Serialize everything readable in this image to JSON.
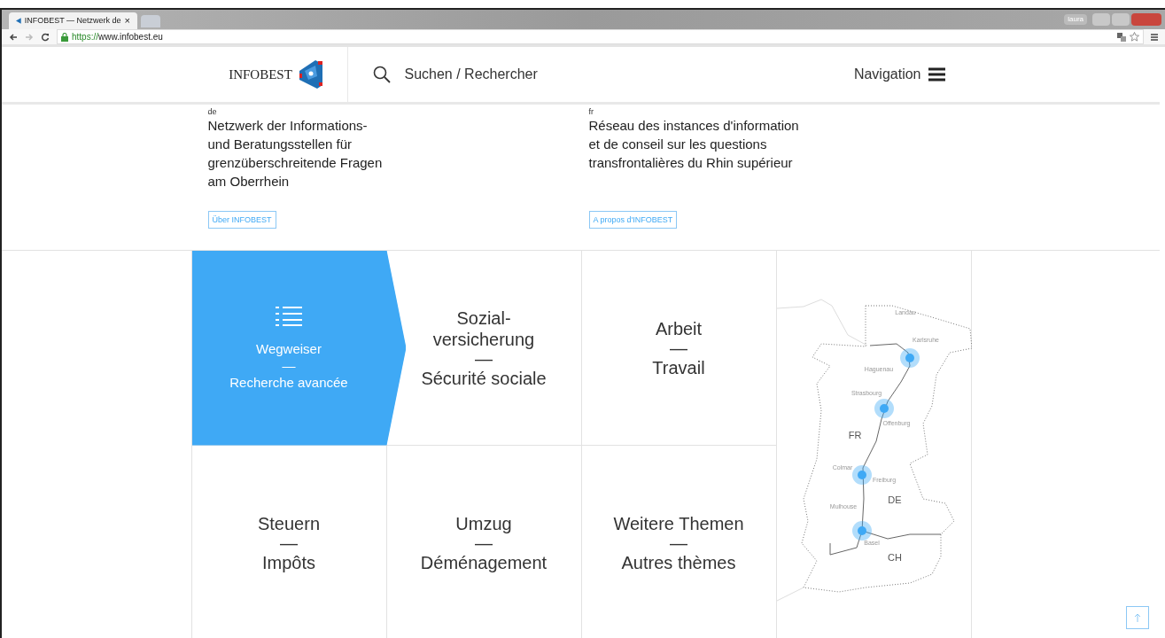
{
  "browser": {
    "tab_title": "INFOBEST — Netzwerk de",
    "tab_close": "×",
    "url_scheme": "https://",
    "url_host": "www.infobest.eu",
    "profile": "laura"
  },
  "header": {
    "logo_text": "INFOBEST",
    "search_label": "Suchen / Rechercher",
    "navigation_label": "Navigation"
  },
  "intro": [
    {
      "lang": "de",
      "text": "Netzwerk der Informations-\nund Beratungsstellen für\ngrenzüberschreitende Fragen\nam Oberrhein",
      "button": "Über INFOBEST"
    },
    {
      "lang": "fr",
      "text": "Réseau des instances d'information\net de conseil sur les questions\ntransfrontalières du Rhin supérieur",
      "button": "A propos d'INFOBEST"
    }
  ],
  "tiles": [
    {
      "de": "Wegweiser",
      "separator": "—",
      "fr": "Recherche avancée",
      "selected": true
    },
    {
      "de": "Sozial-\nversicherung",
      "separator": "—",
      "fr": "Sécurité sociale",
      "selected": false
    },
    {
      "de": "Arbeit",
      "separator": "—",
      "fr": "Travail",
      "selected": false
    },
    {
      "de": "Steuern",
      "separator": "—",
      "fr": "Impôts",
      "selected": false
    },
    {
      "de": "Umzug",
      "separator": "—",
      "fr": "Déménagement",
      "selected": false
    },
    {
      "de": "Weitere Themen",
      "separator": "—",
      "fr": "Autres thèmes",
      "selected": false
    }
  ],
  "map": {
    "labels": [
      {
        "text": "Landau",
        "kind": "city"
      },
      {
        "text": "Karlsruhe",
        "kind": "city"
      },
      {
        "text": "Haguenau",
        "kind": "city"
      },
      {
        "text": "Strasbourg",
        "kind": "city"
      },
      {
        "text": "Offenburg",
        "kind": "city"
      },
      {
        "text": "FR",
        "kind": "country"
      },
      {
        "text": "Colmar",
        "kind": "city"
      },
      {
        "text": "Freiburg",
        "kind": "city"
      },
      {
        "text": "DE",
        "kind": "country"
      },
      {
        "text": "Mulhouse",
        "kind": "city"
      },
      {
        "text": "Basel",
        "kind": "city"
      },
      {
        "text": "CH",
        "kind": "country"
      }
    ]
  }
}
